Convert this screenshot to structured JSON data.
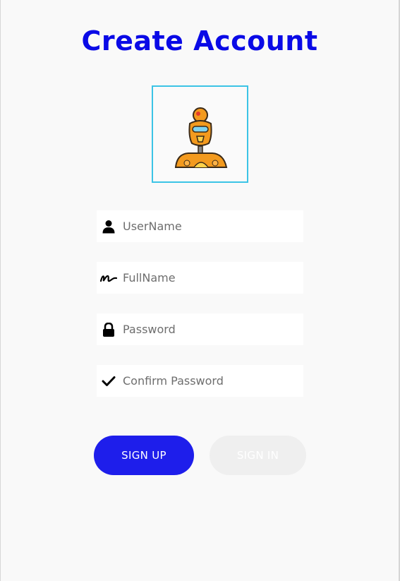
{
  "header": {
    "title": "Create Account"
  },
  "avatar": {
    "icon": "robot-avatar"
  },
  "form": {
    "username": {
      "placeholder": "UserName",
      "value": "",
      "icon": "user-icon"
    },
    "fullname": {
      "placeholder": "FullName",
      "value": "",
      "icon": "signature-icon"
    },
    "password": {
      "placeholder": "Password",
      "value": "",
      "icon": "lock-icon"
    },
    "confirm_password": {
      "placeholder": "Confirm Password",
      "value": "",
      "icon": "check-icon"
    }
  },
  "actions": {
    "signup_label": "SIGN UP",
    "signin_label": "SIGN IN"
  },
  "colors": {
    "title": "#0a0ae6",
    "primary_button": "#1e1eeb",
    "secondary_button": "#efefef",
    "avatar_border": "#3cc4e6"
  }
}
